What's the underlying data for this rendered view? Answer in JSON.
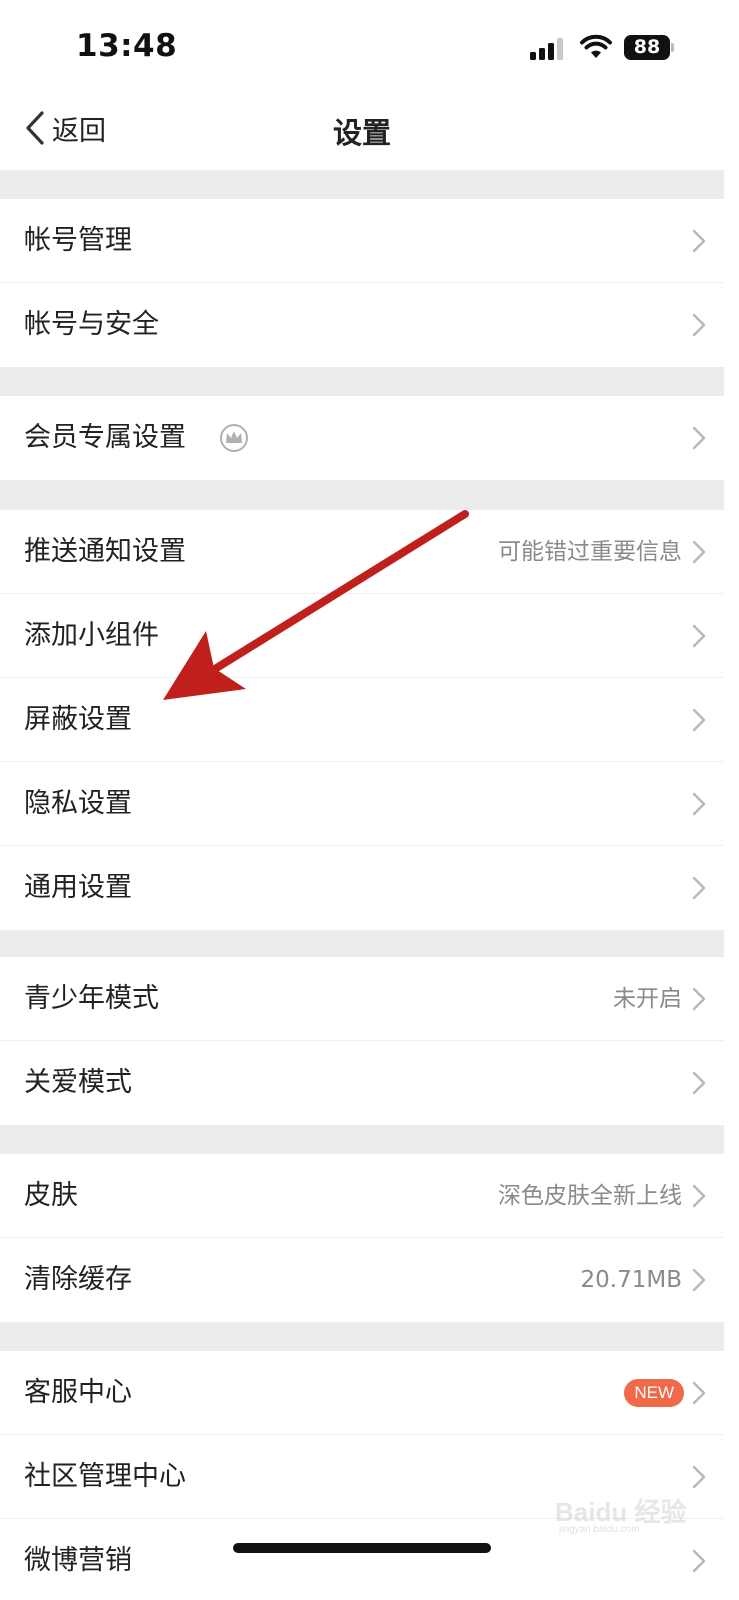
{
  "status_bar": {
    "time": "13:48",
    "battery": "88"
  },
  "nav": {
    "back_label": "返回",
    "title": "设置"
  },
  "groups": [
    {
      "items": [
        {
          "label": "帐号管理"
        },
        {
          "label": "帐号与安全"
        }
      ]
    },
    {
      "items": [
        {
          "label": "会员专属设置",
          "icon": "crown-icon"
        }
      ]
    },
    {
      "items": [
        {
          "label": "推送通知设置",
          "value": "可能错过重要信息"
        },
        {
          "label": "添加小组件"
        },
        {
          "label": "屏蔽设置"
        },
        {
          "label": "隐私设置"
        },
        {
          "label": "通用设置"
        }
      ]
    },
    {
      "items": [
        {
          "label": "青少年模式",
          "value": "未开启"
        },
        {
          "label": "关爱模式"
        }
      ]
    },
    {
      "items": [
        {
          "label": "皮肤",
          "value": "深色皮肤全新上线"
        },
        {
          "label": "清除缓存",
          "value": "20.71MB"
        }
      ]
    },
    {
      "items": [
        {
          "label": "客服中心",
          "badge": "NEW"
        },
        {
          "label": "社区管理中心"
        },
        {
          "label": "微博营销"
        }
      ]
    }
  ],
  "watermark": {
    "main": "Baidu 经验",
    "sub": "jingyan.baidu.com"
  },
  "colors": {
    "annotation_arrow": "#c0201c",
    "badge": "#ef6a48",
    "background": "#ececec"
  }
}
